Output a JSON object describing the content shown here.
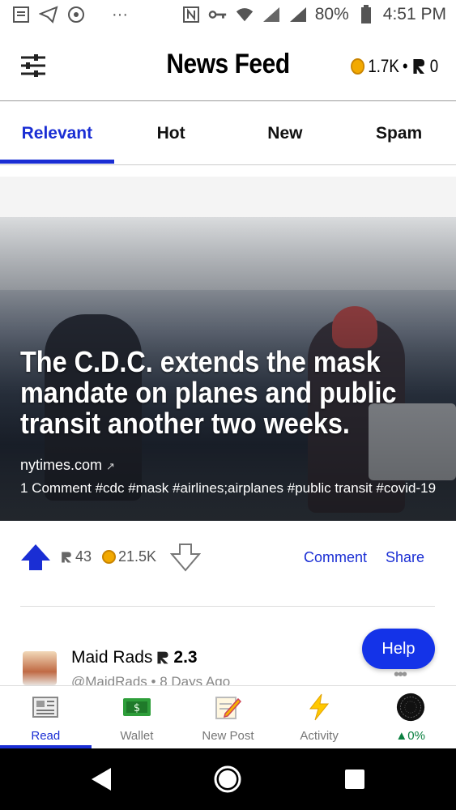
{
  "status_bar": {
    "battery": "80%",
    "time": "4:51 PM"
  },
  "header": {
    "title": "News Feed",
    "coins": "1.7K",
    "separator": "•",
    "rep": "0"
  },
  "tabs": [
    {
      "label": "Relevant",
      "active": true
    },
    {
      "label": "Hot",
      "active": false
    },
    {
      "label": "New",
      "active": false
    },
    {
      "label": "Spam",
      "active": false
    }
  ],
  "article": {
    "headline": "The C.D.C. extends the mask mandate on planes and public transit another two weeks.",
    "source": "nytimes.com",
    "meta": "1 Comment  #cdc #mask #airlines;airplanes #public transit #covid-19"
  },
  "actions": {
    "votes": "43",
    "coins": "21.5K",
    "comment_label": "Comment",
    "share_label": "Share"
  },
  "post": {
    "author": "Maid Rads",
    "rep": "2.3",
    "handle": "@MaidRads",
    "time": "8 Days Ago",
    "more": "•••"
  },
  "help": {
    "label": "Help"
  },
  "bottom_nav": [
    {
      "label": "Read",
      "icon": "newspaper-icon"
    },
    {
      "label": "Wallet",
      "icon": "cash-icon"
    },
    {
      "label": "New Post",
      "icon": "memo-icon"
    },
    {
      "label": "Activity",
      "icon": "lightning-icon"
    },
    {
      "label": "0%",
      "icon": "avatar-icon"
    }
  ],
  "colors": {
    "accent": "#1a2ed4",
    "coin": "#f2a900",
    "positive": "#0a8040"
  }
}
